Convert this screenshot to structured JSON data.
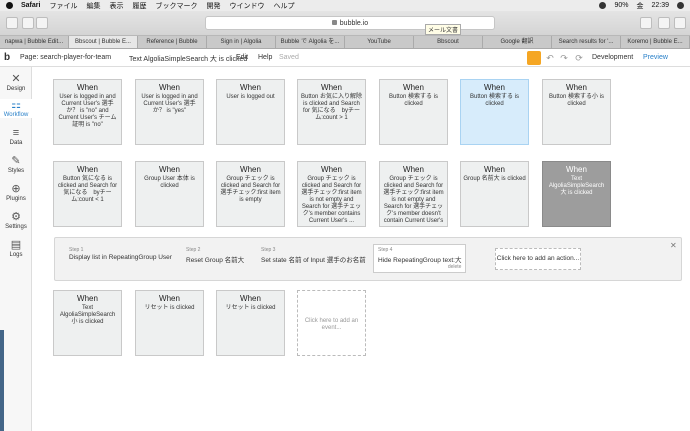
{
  "menubar": {
    "app": "Safari",
    "items": [
      "ファイル",
      "編集",
      "表示",
      "履歴",
      "ブックマーク",
      "開発",
      "ウインドウ",
      "ヘルプ"
    ],
    "battery": "90%",
    "date": "金",
    "time": "22:39"
  },
  "browser": {
    "url": "bubble.io",
    "tooltip": "メール文書",
    "tabs": [
      "napwa | Bubble Edit...",
      "Bbscout | Bubble E...",
      "Reference | Bubble",
      "Sign in | Algolia",
      "Bubble で Algolia を...",
      "YouTube",
      "Bbscout",
      "Google 翻訳",
      "Search results for '...",
      "Koremo | Bubble E..."
    ]
  },
  "header": {
    "logo": "b",
    "page": "Page: search-player-for-team",
    "selection": "Text AlgoliaSimpleSearch 大 is clicked",
    "edit": "Edit",
    "help": "Help",
    "saved": "Saved",
    "version": "Development",
    "preview": "Preview"
  },
  "sidebar": {
    "items": [
      {
        "label": "Design",
        "icon": "design-icon"
      },
      {
        "label": "Workflow",
        "icon": "workflow-icon"
      },
      {
        "label": "Data",
        "icon": "data-icon"
      },
      {
        "label": "Styles",
        "icon": "styles-icon"
      },
      {
        "label": "Plugins",
        "icon": "plugins-icon"
      },
      {
        "label": "Settings",
        "icon": "settings-icon"
      },
      {
        "label": "Logs",
        "icon": "logs-icon"
      }
    ]
  },
  "workflows": {
    "row1": [
      {
        "when": "When",
        "text": "User is logged in and Current User's 選手か？ is \"no\" and Current User's チーム証明 is \"no\""
      },
      {
        "when": "When",
        "text": "User is logged in and Current User's 選手か？ is \"yes\""
      },
      {
        "when": "When",
        "text": "User is logged out"
      },
      {
        "when": "When",
        "text": "Button お気に入り解除 is clicked and Search for 気になる　byチーム:count > 1"
      },
      {
        "when": "When",
        "text": "Button 検索する is clicked"
      },
      {
        "when": "When",
        "text": "Button 検索する is clicked"
      },
      {
        "when": "When",
        "text": "Button 検索する小 is clicked"
      }
    ],
    "row2": [
      {
        "when": "When",
        "text": "Button 気になる is clicked and Search for 気になる　byチーム:count < 1"
      },
      {
        "when": "When",
        "text": "Group User 本体 is clicked"
      },
      {
        "when": "When",
        "text": "Group チェック is clicked and Search for 選手チェック:first item is empty"
      },
      {
        "when": "When",
        "text": "Group チェック is clicked and Search for 選手チェック:first item is not empty and Search for 選手チェック's member contains Current User's ..."
      },
      {
        "when": "When",
        "text": "Group チェック is clicked and Search for 選手チェック:first item is not empty and Search for 選手チェック's member doesn't contain Current User's ..."
      },
      {
        "when": "When",
        "text": "Group 名前大 is clicked"
      },
      {
        "when": "When",
        "text": "Text AlgoliaSimpleSearch 大 is clicked"
      }
    ],
    "row3": [
      {
        "when": "When",
        "text": "Text AlgoliaSimpleSearch 小 is clicked"
      },
      {
        "when": "When",
        "text": "リセット is clicked"
      },
      {
        "when": "When",
        "text": "リセット is clicked"
      }
    ],
    "add_event": "Click here to add an event..."
  },
  "steps": [
    {
      "num": "Step 1",
      "text": "Display list in RepeatingGroup User"
    },
    {
      "num": "Step 2",
      "text": "Reset Group 名前大"
    },
    {
      "num": "Step 3",
      "text": "Set state 名前 of Input 選手のお名前"
    },
    {
      "num": "Step 4",
      "text": "Hide RepeatingGroup text:大",
      "delete": "delete"
    }
  ],
  "add_action": "Click here to add an action..."
}
